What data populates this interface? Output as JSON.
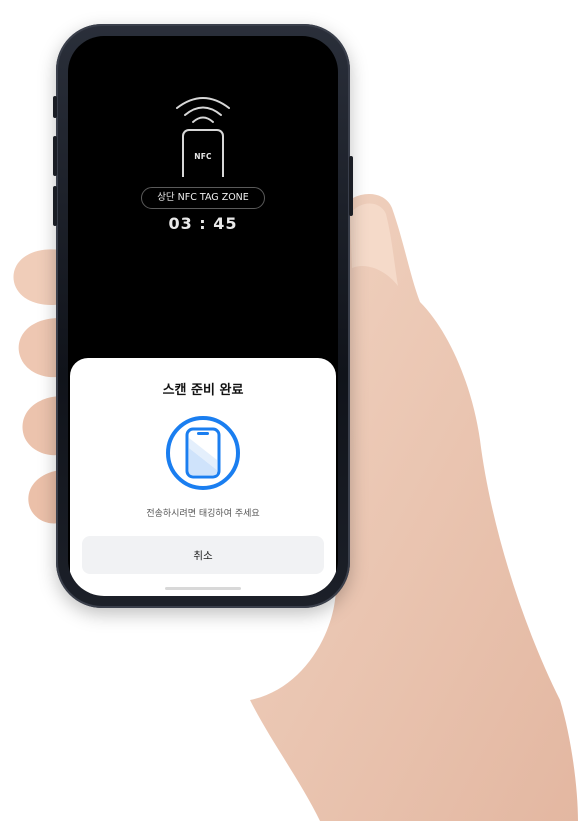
{
  "nfc": {
    "device_label": "NFC",
    "zone_label": "상단 NFC TAG ZONE",
    "timer": "03 : 45"
  },
  "sheet": {
    "title": "스캔 준비 완료",
    "description": "전송하시려면 태깅하여 주세요",
    "cancel_label": "취소"
  },
  "colors": {
    "accent": "#1a7ef0",
    "accent_light": "#cfe3fb",
    "screen_bg": "#000000",
    "sheet_bg": "#ffffff",
    "button_bg": "#f1f2f4"
  },
  "icons": {
    "signal": "nfc-wave-icon",
    "device": "nfc-phone-icon",
    "scan": "phone-scan-icon"
  }
}
